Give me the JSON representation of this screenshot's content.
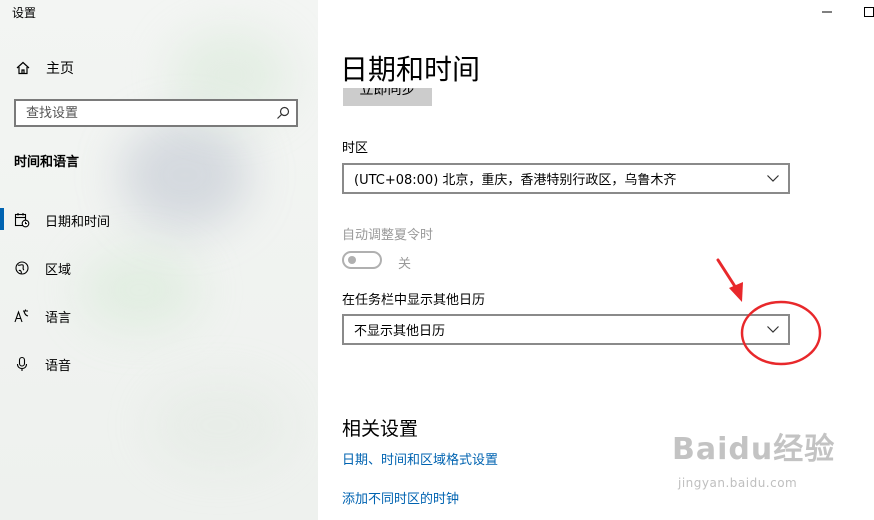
{
  "window": {
    "title": "设置"
  },
  "sidebar": {
    "home_label": "主页",
    "search_placeholder": "查找设置",
    "section_heading": "时间和语言",
    "items": [
      {
        "label": "日期和时间",
        "icon": "calendar-clock-icon",
        "active": true
      },
      {
        "label": "区域",
        "icon": "globe-icon",
        "active": false
      },
      {
        "label": "语言",
        "icon": "language-icon",
        "active": false
      },
      {
        "label": "语音",
        "icon": "microphone-icon",
        "active": false
      }
    ]
  },
  "main": {
    "title": "日期和时间",
    "sync_button_label": "立即同步",
    "timezone": {
      "label": "时区",
      "value": "(UTC+08:00) 北京，重庆，香港特别行政区，乌鲁木齐"
    },
    "dst": {
      "label": "自动调整夏令时",
      "state_label": "关",
      "on": false
    },
    "extra_calendar": {
      "label": "在任务栏中显示其他日历",
      "value": "不显示其他日历"
    },
    "related": {
      "title": "相关设置",
      "links": [
        "日期、时间和区域格式设置",
        "添加不同时区的时钟"
      ]
    }
  },
  "annotation": {
    "color": "#e8282b"
  },
  "watermark": {
    "logo": "Baidu经验",
    "url": "jingyan.baidu.com"
  },
  "colors": {
    "accent": "#0063b1",
    "disabled": "#999999",
    "sidebar_bg": "#eef1ee"
  }
}
